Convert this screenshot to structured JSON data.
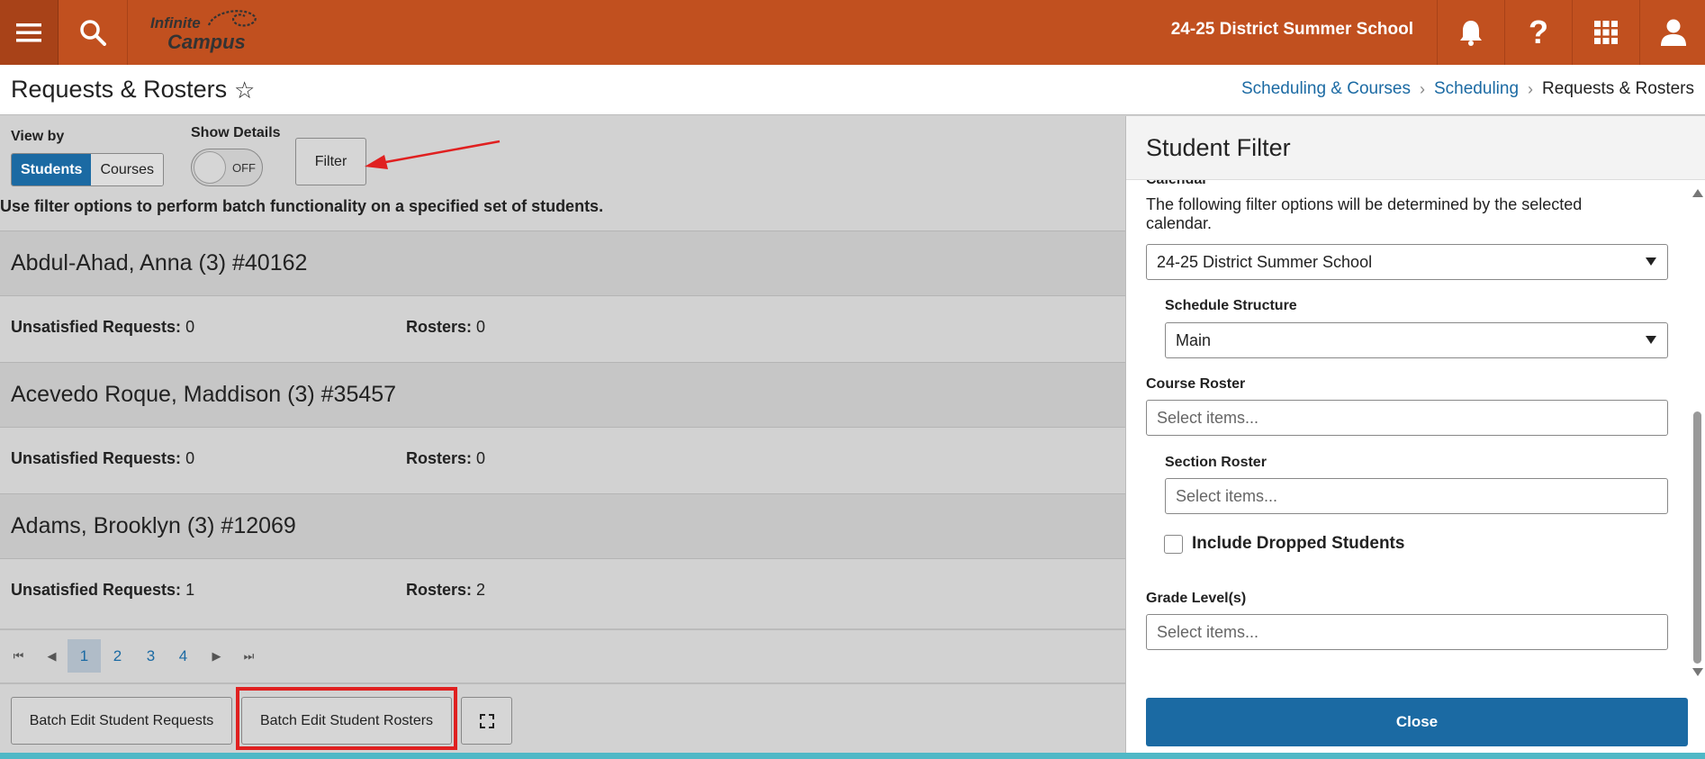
{
  "topbar": {
    "logo_line1": "Infinite",
    "logo_line2": "Campus",
    "district": "24-25 District Summer School"
  },
  "page": {
    "title": "Requests & Rosters",
    "breadcrumbs": [
      "Scheduling & Courses",
      "Scheduling",
      "Requests & Rosters"
    ]
  },
  "controls": {
    "view_by_label": "View by",
    "view_students": "Students",
    "view_courses": "Courses",
    "show_details_label": "Show Details",
    "toggle_state": "OFF",
    "filter_label": "Filter",
    "hint": "Use filter options to perform batch functionality on a specified set of students."
  },
  "students": [
    {
      "name": "Abdul-Ahad, Anna (3) #40162",
      "unsatisfied_label": "Unsatisfied Requests:",
      "unsatisfied": "0",
      "rosters_label": "Rosters:",
      "rosters": "0"
    },
    {
      "name": "Acevedo Roque, Maddison (3) #35457",
      "unsatisfied_label": "Unsatisfied Requests:",
      "unsatisfied": "0",
      "rosters_label": "Rosters:",
      "rosters": "0"
    },
    {
      "name": "Adams, Brooklyn (3) #12069",
      "unsatisfied_label": "Unsatisfied Requests:",
      "unsatisfied": "1",
      "rosters_label": "Rosters:",
      "rosters": "2"
    }
  ],
  "pager": {
    "pages": [
      "1",
      "2",
      "3",
      "4"
    ],
    "current": "1"
  },
  "actions": {
    "batch_requests": "Batch Edit Student Requests",
    "batch_rosters": "Batch Edit Student Rosters"
  },
  "filter_panel": {
    "title": "Student Filter",
    "calendar_label": "Calendar",
    "calendar_note": "The following filter options will be determined by the selected calendar.",
    "calendar_value": "24-25 District Summer School",
    "schedule_structure_label": "Schedule Structure",
    "schedule_structure_value": "Main",
    "course_roster_label": "Course Roster",
    "course_roster_placeholder": "Select items...",
    "section_roster_label": "Section Roster",
    "section_roster_placeholder": "Select items...",
    "include_dropped_label": "Include Dropped Students",
    "grade_level_label": "Grade Level(s)",
    "grade_level_placeholder": "Select items...",
    "close_label": "Close"
  },
  "colors": {
    "topbar": "#c1501f",
    "accent_blue": "#1b6aa3",
    "highlight_red": "#e02020",
    "strip_teal": "#4fb8c6"
  }
}
